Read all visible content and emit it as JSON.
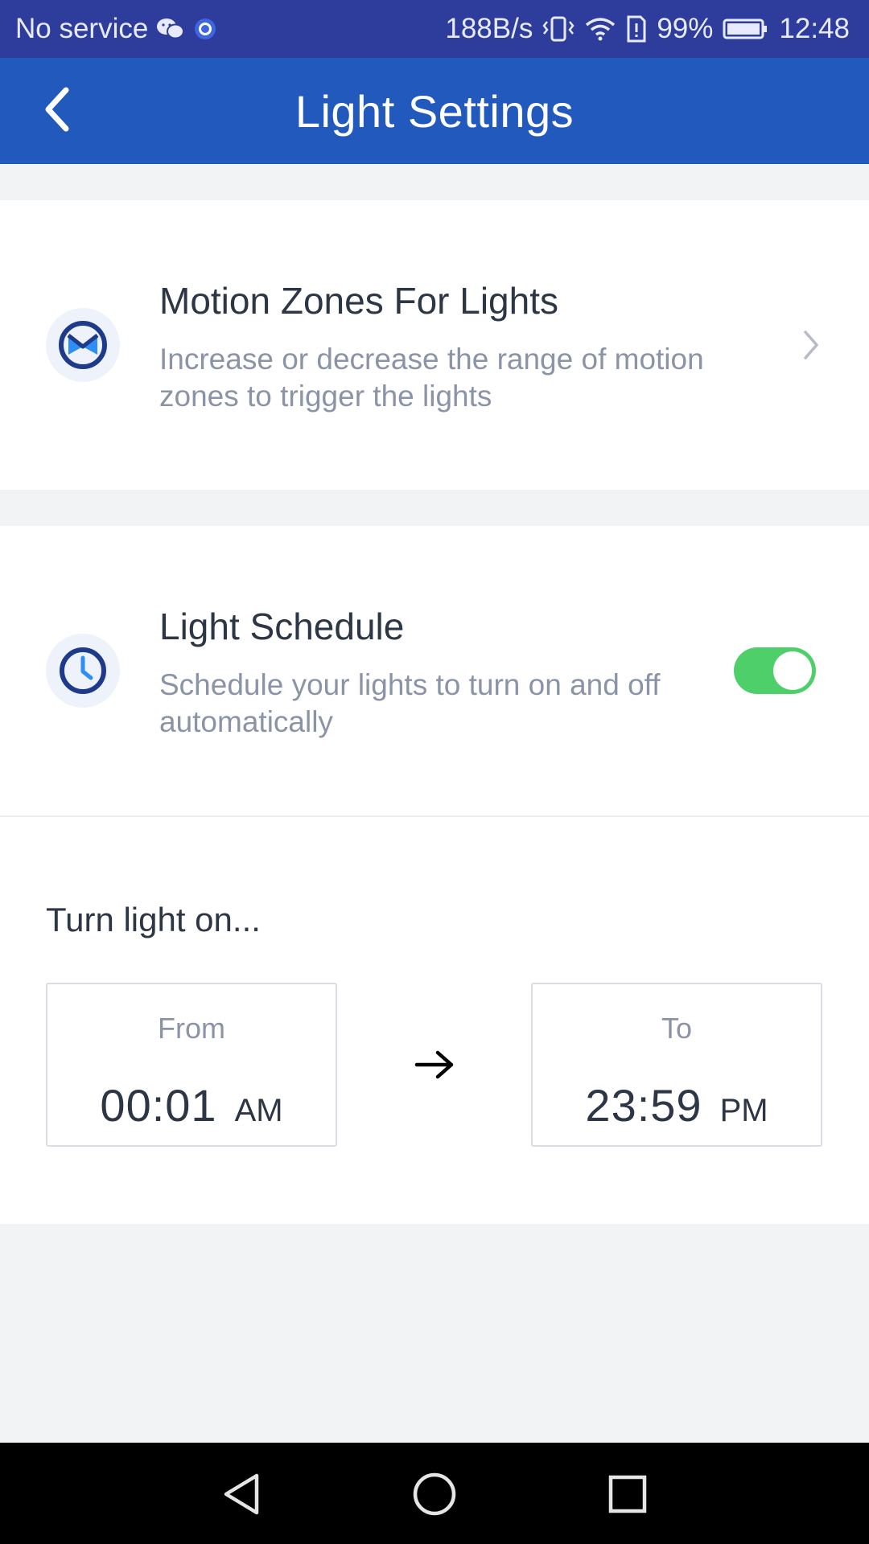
{
  "status_bar": {
    "carrier": "No service",
    "net_speed": "188B/s",
    "battery": "99%",
    "time": "12:48",
    "icons": [
      "wechat-icon",
      "notification-dot-icon",
      "vibrate-icon",
      "wifi-icon",
      "sim-alert-icon",
      "battery-icon"
    ]
  },
  "app_bar": {
    "title": "Light Settings",
    "back_icon": "chevron-left-icon"
  },
  "motion_zones": {
    "title": "Motion Zones For Lights",
    "description": "Increase or decrease the range of motion zones to trigger the lights",
    "icon": "motion-zone-icon",
    "action_icon": "chevron-right-icon"
  },
  "light_schedule": {
    "title": "Light Schedule",
    "description": "Schedule your lights to turn on and off automatically",
    "icon": "clock-icon",
    "enabled": true
  },
  "schedule": {
    "heading": "Turn light on...",
    "from": {
      "label": "From",
      "time": "00:01",
      "period": "AM"
    },
    "to": {
      "label": "To",
      "time": "23:59",
      "period": "PM"
    },
    "arrow_icon": "arrow-right-icon"
  },
  "nav_bar": {
    "buttons": [
      "back-triangle-icon",
      "home-circle-icon",
      "recents-square-icon"
    ]
  },
  "colors": {
    "status_bar": "#2e3c9c",
    "app_bar": "#2159bd",
    "toggle_on": "#4ecf6a",
    "icon_blue": "#1e3a8a",
    "title_text": "#2d3644",
    "desc_text": "#8a94a6",
    "background": "#f2f3f5"
  }
}
